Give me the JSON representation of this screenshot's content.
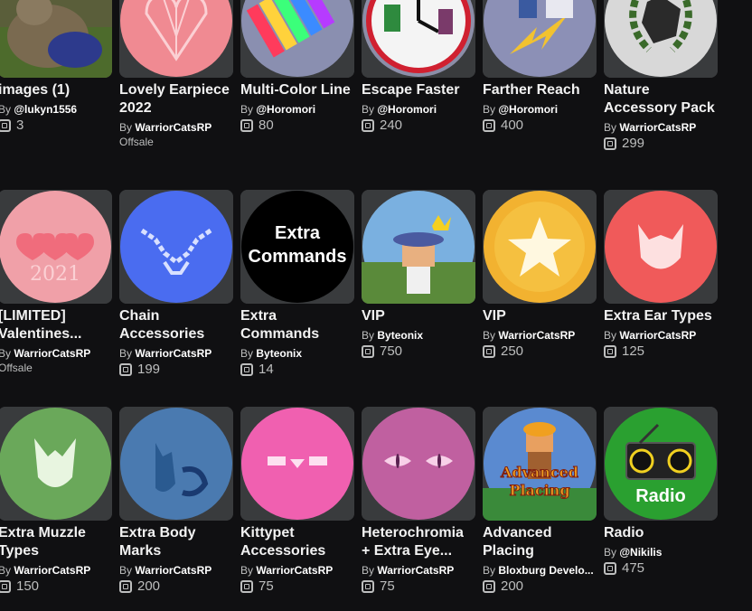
{
  "items": [
    {
      "name": "images (1)",
      "creator_prefix": "By",
      "creator": "@lukyn1556",
      "price": "3",
      "offsale": "",
      "icon": "dog-photo-icon"
    },
    {
      "name": "Lovely Earpiece 2022",
      "creator_prefix": "By",
      "creator": "WarriorCatsRP",
      "price": "",
      "offsale": "Offsale",
      "icon": "heart-2022-icon"
    },
    {
      "name": "Multi-Color Line",
      "creator_prefix": "By",
      "creator": "@Horomori",
      "price": "80",
      "offsale": "",
      "icon": "color-palette-icon"
    },
    {
      "name": "Escape Faster",
      "creator_prefix": "By",
      "creator": "@Horomori",
      "price": "240",
      "offsale": "",
      "icon": "clock-icon"
    },
    {
      "name": "Farther Reach",
      "creator_prefix": "By",
      "creator": "@Horomori",
      "price": "400",
      "offsale": "",
      "icon": "lightning-icon"
    },
    {
      "name": "Nature Accessory Pack",
      "creator_prefix": "By",
      "creator": "WarriorCatsRP",
      "price": "299",
      "offsale": "",
      "icon": "laurel-stone-icon"
    },
    {
      "name": "[LIMITED] Valentines...",
      "creator_prefix": "By",
      "creator": "WarriorCatsRP",
      "price": "",
      "offsale": "Offsale",
      "icon": "hearts-2021-icon",
      "badge_text": "2021"
    },
    {
      "name": "Chain Accessories",
      "creator_prefix": "By",
      "creator": "WarriorCatsRP",
      "price": "199",
      "offsale": "",
      "icon": "chain-icon"
    },
    {
      "name": "Extra Commands",
      "creator_prefix": "By",
      "creator": "Byteonix",
      "price": "14",
      "offsale": "",
      "icon": "extra-commands-icon",
      "badge_line1": "Extra",
      "badge_line2": "Commands"
    },
    {
      "name": "VIP",
      "creator_prefix": "By",
      "creator": "Byteonix",
      "price": "750",
      "offsale": "",
      "icon": "avatar-crown-icon"
    },
    {
      "name": "VIP",
      "creator_prefix": "By",
      "creator": "WarriorCatsRP",
      "price": "250",
      "offsale": "",
      "icon": "star-icon"
    },
    {
      "name": "Extra Ear Types",
      "creator_prefix": "By",
      "creator": "WarriorCatsRP",
      "price": "125",
      "offsale": "",
      "icon": "cat-ear-icon"
    },
    {
      "name": "Extra Muzzle Types",
      "creator_prefix": "By",
      "creator": "WarriorCatsRP",
      "price": "150",
      "offsale": "",
      "icon": "cat-muzzle-icon"
    },
    {
      "name": "Extra Body Marks",
      "creator_prefix": "By",
      "creator": "WarriorCatsRP",
      "price": "200",
      "offsale": "",
      "icon": "cat-silhouette-icon"
    },
    {
      "name": "Kittypet Accessories",
      "creator_prefix": "By",
      "creator": "WarriorCatsRP",
      "price": "75",
      "offsale": "",
      "icon": "collar-icon"
    },
    {
      "name": "Heterochromia + Extra Eye...",
      "creator_prefix": "By",
      "creator": "WarriorCatsRP",
      "price": "75",
      "offsale": "",
      "icon": "cat-eyes-icon"
    },
    {
      "name": "Advanced Placing",
      "creator_prefix": "By",
      "creator": "Bloxburg Develo...",
      "price": "200",
      "offsale": "",
      "icon": "builder-icon",
      "badge_line1": "Advanced",
      "badge_line2": "Placing"
    },
    {
      "name": "Radio",
      "creator_prefix": "By",
      "creator": "@Nikilis",
      "price": "475",
      "offsale": "",
      "icon": "radio-icon",
      "badge_text": "Radio"
    }
  ]
}
